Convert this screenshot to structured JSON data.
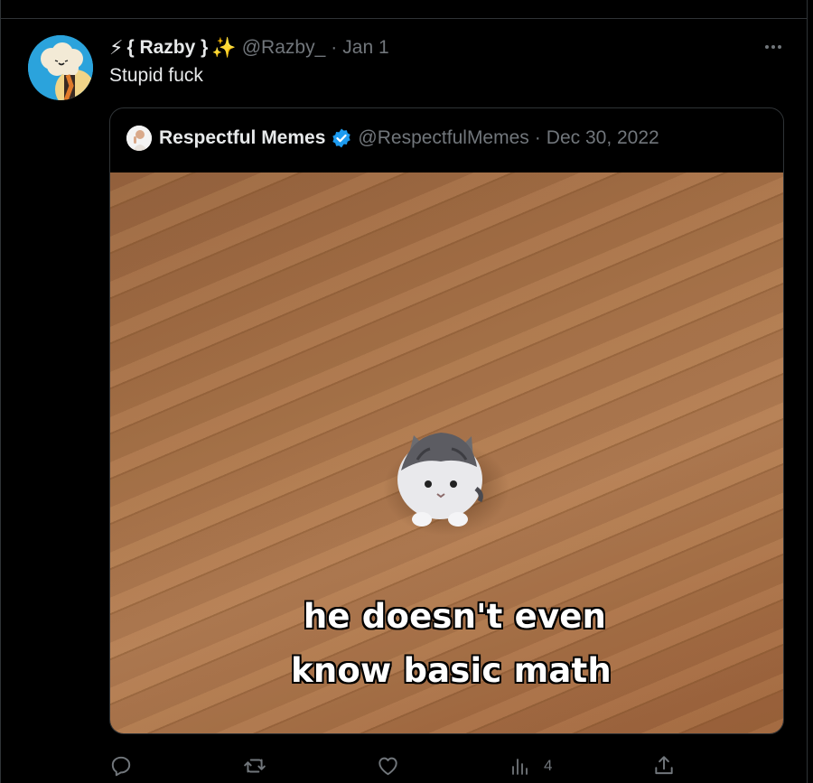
{
  "tweet": {
    "avatar_icon": "avatar-cartoon-icon",
    "name_prefix_emoji": "⚡",
    "display_name": "{ Razby }",
    "name_suffix_emoji": "✨",
    "handle": "@Razby_",
    "separator": "·",
    "date": "Jan 1",
    "text": "Stupid fuck",
    "more_icon": "more-icon"
  },
  "quoted": {
    "avatar_icon": "avatar-icon",
    "display_name": "Respectful Memes",
    "verified_icon": "verified-badge-icon",
    "handle": "@RespectfulMemes",
    "separator": "·",
    "date": "Dec 30, 2022",
    "media": {
      "description_icon": "kitten-meme-image",
      "caption_line1": "he doesn't even",
      "caption_line2": "know basic math"
    }
  },
  "actions": {
    "reply": {
      "icon": "reply-icon",
      "count": ""
    },
    "retweet": {
      "icon": "retweet-icon",
      "count": ""
    },
    "like": {
      "icon": "heart-icon",
      "count": ""
    },
    "views": {
      "icon": "views-icon",
      "count": "4"
    },
    "share": {
      "icon": "share-icon",
      "count": ""
    }
  },
  "colors": {
    "background": "#000000",
    "text_primary": "#e7e9ea",
    "text_secondary": "#71767b",
    "border": "#2f3336",
    "verified": "#1d9bf0"
  }
}
